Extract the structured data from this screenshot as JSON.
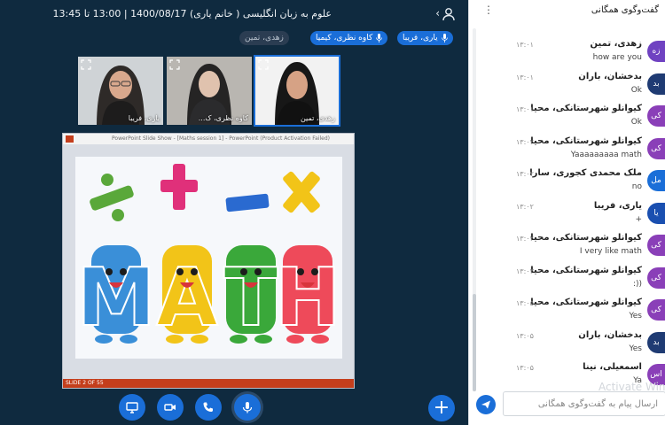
{
  "meeting": {
    "title": "علوم به زبان انگلیسی ( خانم یاری) 1400/08/17 | 13:00 تا 13:45"
  },
  "speakers": [
    {
      "name": "یاری، فریبا",
      "talking": true
    },
    {
      "name": "کاوه نظری، کیمیا",
      "talking": true
    },
    {
      "name": "زهدی، تمین",
      "talking": false
    }
  ],
  "video_tiles": [
    {
      "name": "یاری، فریبا"
    },
    {
      "name": "کاوه نظری، ک..."
    },
    {
      "name": "زهدی، تمین"
    }
  ],
  "slide": {
    "window_title": "PowerPoint Slide Show - [Maths session 1] - PowerPoint (Product Activation Failed)",
    "word": "MATH",
    "counter": "SLIDE 2 OF 55",
    "symbol_colors": [
      "#5aa83a",
      "#e0307a",
      "#2a6ad0",
      "#f2c418"
    ],
    "letter_colors": [
      "#3a8fd8",
      "#f2c418",
      "#3aa83a",
      "#ee4a5a"
    ]
  },
  "controls": {
    "plus": "+"
  },
  "chat": {
    "title": "گفت‌وگوی همگانی",
    "input_placeholder": "ارسال پیام به گفت‌وگوی همگانی",
    "watermark": "Activate Win",
    "messages": [
      {
        "initials": "زه",
        "color": "#6f42c1",
        "name": "زهدی، تمین",
        "time": "۱۳:۰۱",
        "text": "how are you"
      },
      {
        "initials": "بد",
        "color": "#1f3b73",
        "name": "بدخشان، باران",
        "time": "۱۳:۰۱",
        "text": "Ok"
      },
      {
        "initials": "کی",
        "color": "#8a3fb8",
        "name": "کیوانلو شهرستانکی، محیا",
        "time": "۱۳:۰۱",
        "text": "Ok"
      },
      {
        "initials": "کی",
        "color": "#8a3fb8",
        "name": "کیوانلو شهرستانکی، محیا",
        "time": "۱۳:۰۲",
        "text": "Yaaaaaaaaa math"
      },
      {
        "initials": "مل",
        "color": "#1a6ed8",
        "name": "ملک محمدی کجوری، سارا",
        "time": "۱۳:۰۲",
        "text": "no"
      },
      {
        "initials": "یا",
        "color": "#1a4fb0",
        "name": "یاری، فریبا",
        "time": "۱۳:۰۲",
        "text": "+"
      },
      {
        "initials": "کی",
        "color": "#8a3fb8",
        "name": "کیوانلو شهرستانکی، محیا",
        "time": "۱۳:۰۲",
        "text": "I very like math"
      },
      {
        "initials": "کی",
        "color": "#8a3fb8",
        "name": "کیوانلو شهرستانکی، محیا",
        "time": "۱۳:۰۳",
        "text": ":))"
      },
      {
        "initials": "کی",
        "color": "#8a3fb8",
        "name": "کیوانلو شهرستانکی، محیا",
        "time": "۱۳:۰۵",
        "text": "Yes"
      },
      {
        "initials": "بد",
        "color": "#1f3b73",
        "name": "بدخشان، باران",
        "time": "۱۳:۰۵",
        "text": "Yes"
      },
      {
        "initials": "اس",
        "color": "#8a3fb8",
        "name": "اسمعیلی، نینا",
        "time": "۱۳:۰۵",
        "text": "Ya"
      }
    ]
  }
}
